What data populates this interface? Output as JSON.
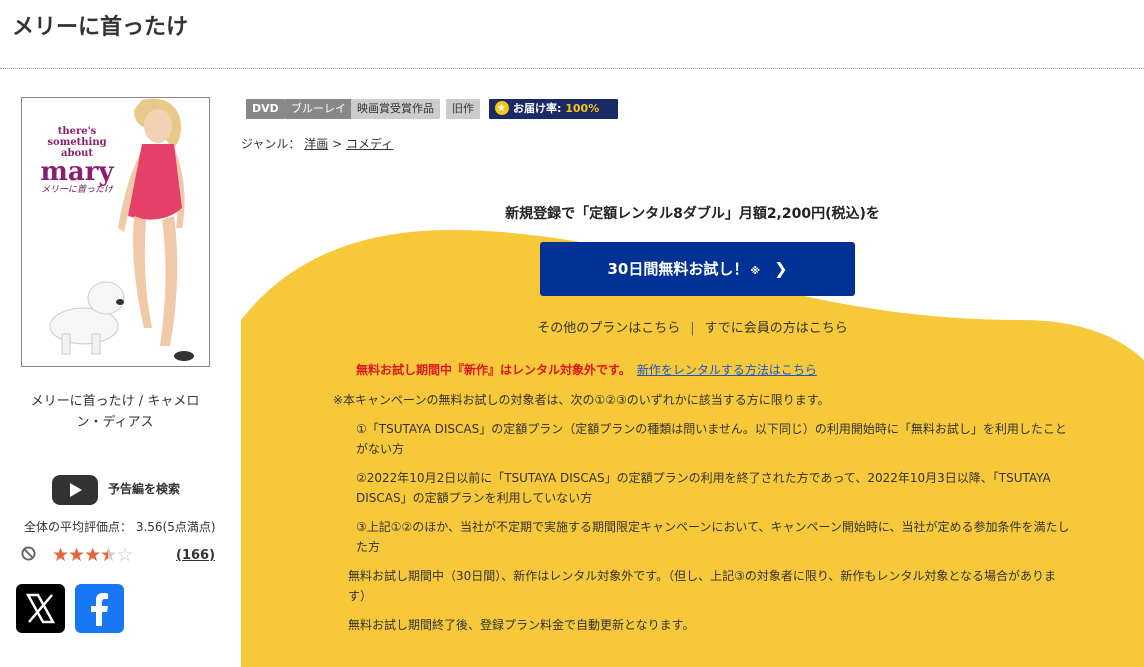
{
  "page": {
    "title": "メリーに首ったけ"
  },
  "poster": {
    "title_en_1": "there's",
    "title_en_2": "something",
    "title_en_3": "about",
    "title_en_4": "mary",
    "title_jp": "メリーに首ったけ",
    "caption": "メリーに首ったけ / キャメロン・ディアス"
  },
  "trailer": {
    "label": "予告編を検索",
    "icon": "play-icon"
  },
  "rating": {
    "avg_text": "全体の平均評価点： 3.56(5点満点)",
    "value": 3.56,
    "max": 5,
    "count_text": "(166)"
  },
  "share": {
    "x_icon": "x-logo-icon",
    "fb_icon": "facebook-icon"
  },
  "tags": {
    "dvd": "DVD",
    "bluray": "ブルーレイ",
    "award": "映画賞受賞作品",
    "old": "旧作",
    "delivery_label": "お届け率:",
    "delivery_value": "100%"
  },
  "genre": {
    "label": "ジャンル：",
    "item1": "洋画",
    "sep": ">",
    "item2": "コメディ"
  },
  "promo": {
    "headline": "新規登録で「定額レンタル8ダブル」月額2,200円(税込)を",
    "button_label": "30日間無料お試し！",
    "button_note": "※",
    "other_plans": "その他のプランはこちら",
    "divider": "|",
    "members": "すでに会員の方はこちら"
  },
  "notice": {
    "warning": "無料お試し期間中『新作』はレンタル対象外です。",
    "warning_link": "新作をレンタルする方法はこちら",
    "line1": "※本キャンペーンの無料お試しの対象者は、次の①②③のいずれかに該当する方に限ります。",
    "line2": "①「TSUTAYA DISCAS」の定額プラン（定額プランの種類は問いません。以下同じ）の利用開始時に「無料お試し」を利用したことがない方",
    "line3": "②2022年10月2日以前に「TSUTAYA DISCAS」の定額プランの利用を終了された方であって、2022年10月3日以降、「TSUTAYA DISCAS」の定額プランを利用していない方",
    "line4": "③上記①②のほか、当社が不定期で実施する期間限定キャンペーンにおいて、キャンペーン開始時に、当社が定める参加条件を満たした方",
    "line5": "無料お試し期間中（30日間）、新作はレンタル対象外です。（但し、上記③の対象者に限り、新作もレンタル対象となる場合があります）",
    "line6": "無料お試し期間終了後、登録プラン料金で自動更新となります。"
  },
  "colors": {
    "accent_yellow": "#f7c93a",
    "button_blue": "#003296",
    "warning_red": "#e0161e",
    "link_blue": "#1a57c8"
  }
}
